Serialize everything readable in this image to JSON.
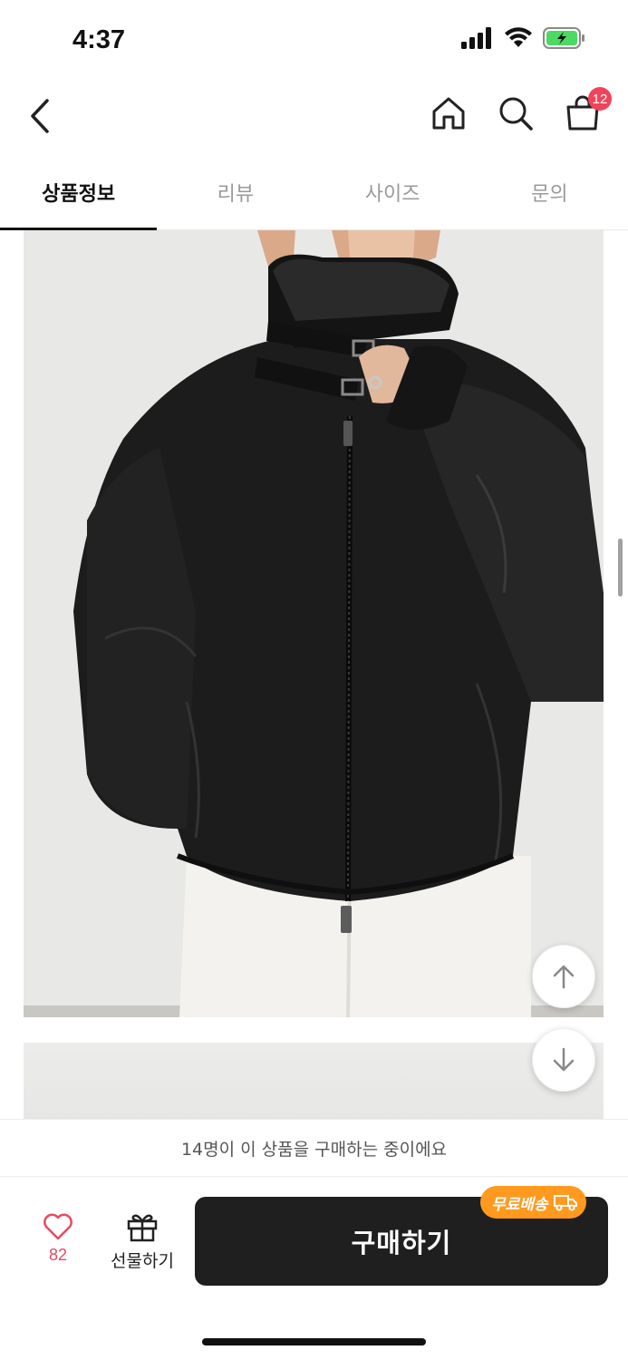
{
  "status_bar": {
    "time": "4:37"
  },
  "header": {
    "cart_count": "12"
  },
  "tabs": [
    {
      "label": "상품정보",
      "active": true
    },
    {
      "label": "리뷰",
      "active": false
    },
    {
      "label": "사이즈",
      "active": false
    },
    {
      "label": "문의",
      "active": false
    }
  ],
  "buying_banner": "14명이 이 상품을 구매하는 중이에요",
  "bottom_bar": {
    "like_count": "82",
    "gift_label": "선물하기",
    "buy_label": "구매하기",
    "free_shipping_badge": "무료배송"
  },
  "colors": {
    "accent_red": "#f2435a",
    "buy_button": "#1f1f1f",
    "badge_orange": "#ff9a1f"
  },
  "icons": [
    "back-icon",
    "home-icon",
    "search-icon",
    "cart-icon",
    "arrow-up-icon",
    "arrow-down-icon",
    "heart-icon",
    "gift-icon",
    "truck-icon"
  ]
}
